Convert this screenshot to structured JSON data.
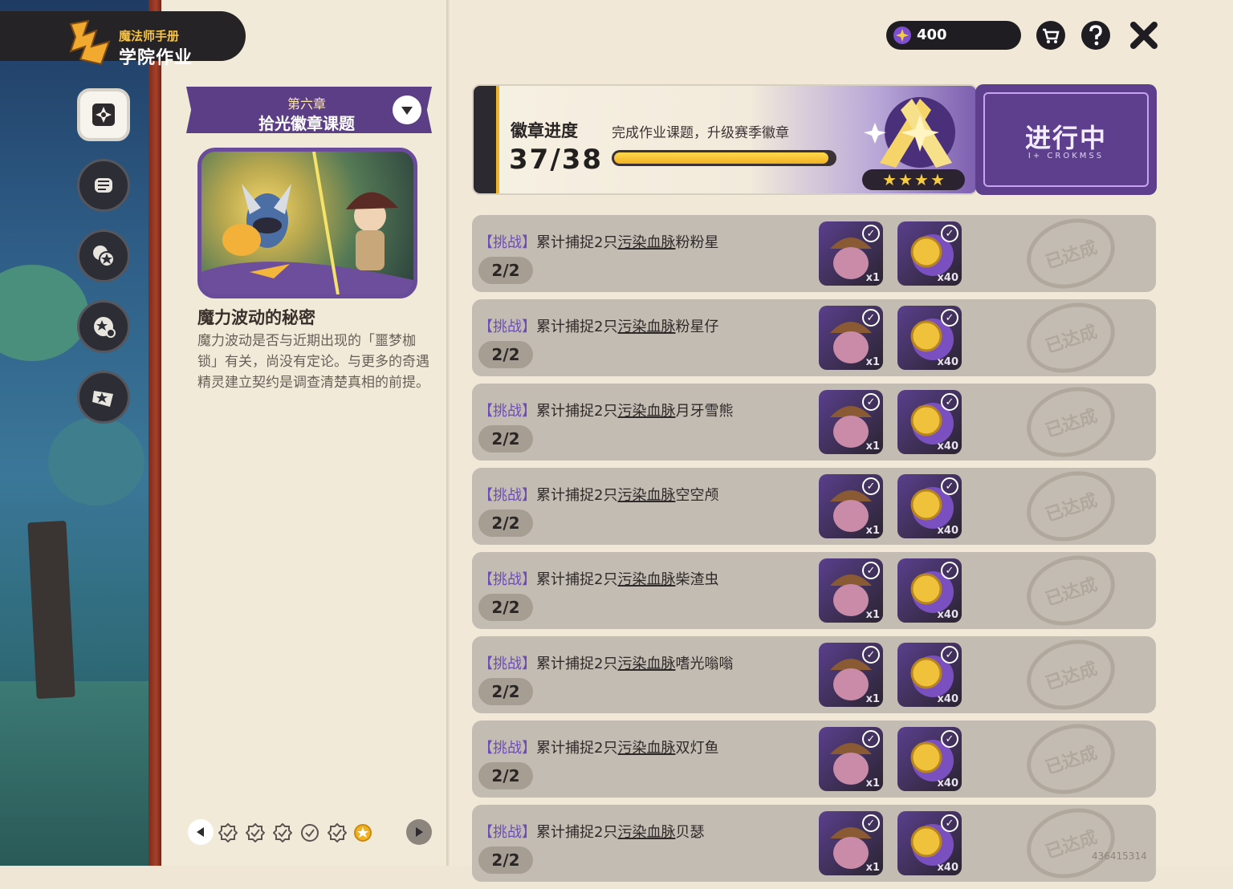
{
  "header": {
    "subtitle": "魔法师手册",
    "title": "学院作业"
  },
  "sidebar": {
    "items": [
      {
        "name": "homework",
        "icon": "compass-book-icon",
        "active": true
      },
      {
        "name": "fist",
        "icon": "fist-icon",
        "active": false
      },
      {
        "name": "badges",
        "icon": "star-badges-icon",
        "active": false
      },
      {
        "name": "stars",
        "icon": "star-orbit-icon",
        "active": false
      },
      {
        "name": "ticket",
        "icon": "star-ticket-icon",
        "active": false
      }
    ]
  },
  "chapter": {
    "number": "第六章",
    "title": "拾光徽章课题"
  },
  "story": {
    "title": "魔力波动的秘密",
    "text": "魔力波动是否与近期出现的「噩梦枷锁」有关，尚没有定论。与更多的奇遇精灵建立契约是调查清楚真相的前提。"
  },
  "pager": {
    "pages": [
      "done",
      "done",
      "done",
      "done",
      "done",
      "current"
    ]
  },
  "top": {
    "currency": "400"
  },
  "progress": {
    "title": "徽章进度",
    "description": "完成作业课题，升级赛季徽章",
    "count": "37/38",
    "fraction": 0.9737,
    "stars": 4
  },
  "status": {
    "label": "进行中",
    "sub": "I+ CROKMSS"
  },
  "quests": [
    {
      "tag": "【挑战】",
      "prefix": "累计捕捉2只",
      "keyword": "污染血脉",
      "target": "粉粉星",
      "progress": "2/2",
      "rewards": [
        "x1",
        "x40"
      ],
      "stamp": "已达成"
    },
    {
      "tag": "【挑战】",
      "prefix": "累计捕捉2只",
      "keyword": "污染血脉",
      "target": "粉星仔",
      "progress": "2/2",
      "rewards": [
        "x1",
        "x40"
      ],
      "stamp": "已达成"
    },
    {
      "tag": "【挑战】",
      "prefix": "累计捕捉2只",
      "keyword": "污染血脉",
      "target": "月牙雪熊",
      "progress": "2/2",
      "rewards": [
        "x1",
        "x40"
      ],
      "stamp": "已达成"
    },
    {
      "tag": "【挑战】",
      "prefix": "累计捕捉2只",
      "keyword": "污染血脉",
      "target": "空空颅",
      "progress": "2/2",
      "rewards": [
        "x1",
        "x40"
      ],
      "stamp": "已达成"
    },
    {
      "tag": "【挑战】",
      "prefix": "累计捕捉2只",
      "keyword": "污染血脉",
      "target": "柴渣虫",
      "progress": "2/2",
      "rewards": [
        "x1",
        "x40"
      ],
      "stamp": "已达成"
    },
    {
      "tag": "【挑战】",
      "prefix": "累计捕捉2只",
      "keyword": "污染血脉",
      "target": "嗜光嗡嗡",
      "progress": "2/2",
      "rewards": [
        "x1",
        "x40"
      ],
      "stamp": "已达成"
    },
    {
      "tag": "【挑战】",
      "prefix": "累计捕捉2只",
      "keyword": "污染血脉",
      "target": "双灯鱼",
      "progress": "2/2",
      "rewards": [
        "x1",
        "x40"
      ],
      "stamp": "已达成"
    },
    {
      "tag": "【挑战】",
      "prefix": "累计捕捉2只",
      "keyword": "污染血脉",
      "target": "贝瑟",
      "progress": "2/2",
      "rewards": [
        "x1",
        "x40"
      ],
      "stamp": "已达成"
    }
  ],
  "uid": "436415314",
  "colors": {
    "accent": "#5e3f8d",
    "progress_fill": "#f0b221",
    "tag": "#6d4db5",
    "titlebar": "#262326"
  }
}
